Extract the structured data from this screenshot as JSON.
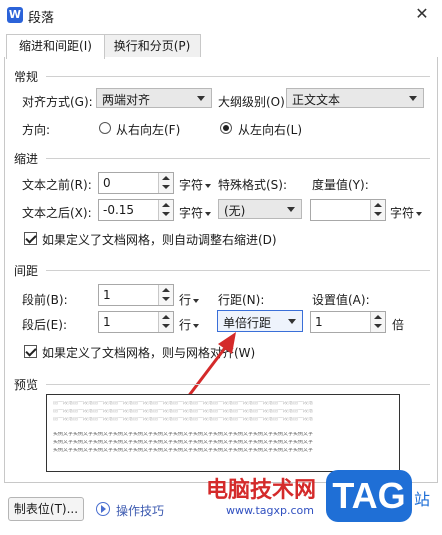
{
  "window": {
    "title": "段落",
    "app_icon_letter": "W"
  },
  "tabs": [
    {
      "label": "缩进和间距(I)",
      "active": true
    },
    {
      "label": "换行和分页(P)",
      "active": false
    }
  ],
  "general": {
    "section_title": "常规",
    "alignment_label": "对齐方式(G):",
    "alignment_value": "两端对齐",
    "outline_label": "大纲级别(O):",
    "outline_value": "正文文本",
    "direction_label": "方向:",
    "rtl_label": "从右向左(F)",
    "ltr_label": "从左向右(L)",
    "ltr_selected": true
  },
  "indent": {
    "section_title": "缩进",
    "before_label": "文本之前(R):",
    "before_value": "0",
    "before_unit": "字符",
    "special_label": "特殊格式(S):",
    "special_value": "(无)",
    "measure_label": "度量值(Y):",
    "measure_value": "",
    "measure_unit": "字符",
    "after_label": "文本之后(X):",
    "after_value": "-0.15",
    "after_unit": "字符",
    "grid_checkbox_label": "如果定义了文档网格，则自动调整右缩进(D)",
    "grid_checked": true
  },
  "spacing": {
    "section_title": "间距",
    "before_label": "段前(B):",
    "before_value": "1",
    "before_unit": "行",
    "line_label": "行距(N):",
    "line_value": "单倍行距",
    "setting_label": "设置值(A):",
    "setting_value": "1",
    "setting_unit": "倍",
    "after_label": "段后(E):",
    "after_value": "1",
    "after_unit": "行",
    "grid_checkbox_label": "如果定义了文档网格，则与网格对齐(W)",
    "grid_checked": true
  },
  "preview": {
    "section_title": "预览",
    "prev_text": "前一段落前一段落前一段落前一段落前一段落前一段落前一段落前一段落前一段落前一段落前一段落前一段落前一段落",
    "sample_text": "实例文字实例文字实例文字实例文字实例文字实例文字实例文字实例文字实例文字实例文字实例文字实例文字实例文字"
  },
  "footer": {
    "tab_stops_button": "制表位(T)...",
    "tips_link": "操作技巧"
  },
  "watermark": {
    "site_name": "电脑技术网",
    "url": "www.tagxp.com",
    "badge": "TAG",
    "badge_suffix": "站"
  },
  "colors": {
    "accent": "#3a6fd8",
    "arrow": "#d42a2a",
    "watermark_blue": "#1f6fd6"
  }
}
